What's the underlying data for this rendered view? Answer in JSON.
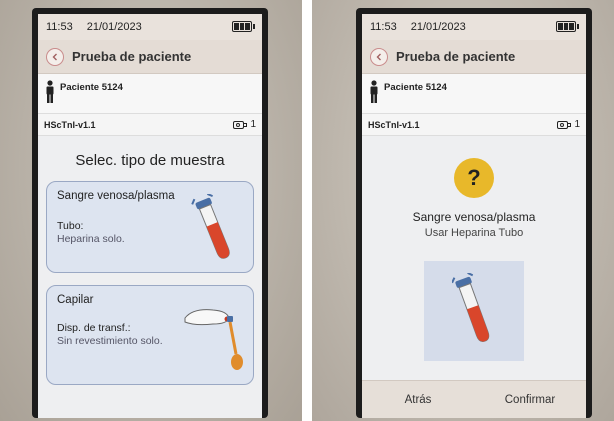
{
  "left_screen": {
    "status": {
      "time": "11:53",
      "date": "21/01/2023",
      "battery_icon": "battery-icon"
    },
    "title": "Prueba de paciente",
    "back_icon": "chevron-left-icon",
    "patient": {
      "label": "Paciente 5124",
      "icon": "person-icon"
    },
    "assay": {
      "name": "HScTnI-v1.1",
      "count": "1",
      "icon": "cartridge-icon"
    },
    "heading": "Selec. tipo de muestra",
    "options": [
      {
        "name": "Sangre venosa/plasma",
        "detail_label": "Tubo:",
        "detail_value": "Heparina solo.",
        "icon": "blood-tube-icon"
      },
      {
        "name": "Capilar",
        "detail_label": "Disp. de transf.:",
        "detail_value": "Sin revestimiento solo.",
        "icon": "finger-pipette-icon"
      }
    ]
  },
  "right_screen": {
    "status": {
      "time": "11:53",
      "date": "21/01/2023",
      "battery_icon": "battery-icon"
    },
    "title": "Prueba de paciente",
    "back_icon": "chevron-left-icon",
    "patient": {
      "label": "Paciente 5124",
      "icon": "person-icon"
    },
    "assay": {
      "name": "HScTnI-v1.1",
      "count": "1",
      "icon": "cartridge-icon"
    },
    "question_mark": "?",
    "confirm_title": "Sangre venosa/plasma",
    "confirm_subtitle": "Usar Heparina Tubo",
    "tube_icon": "blood-tube-icon",
    "buttons": {
      "back": "Atrás",
      "confirm": "Confirmar"
    }
  },
  "colors": {
    "accent_yellow": "#e8b82a",
    "card_border": "#9aa8c4",
    "back_button_border": "#c98c8c",
    "blood_red": "#d9462b"
  }
}
